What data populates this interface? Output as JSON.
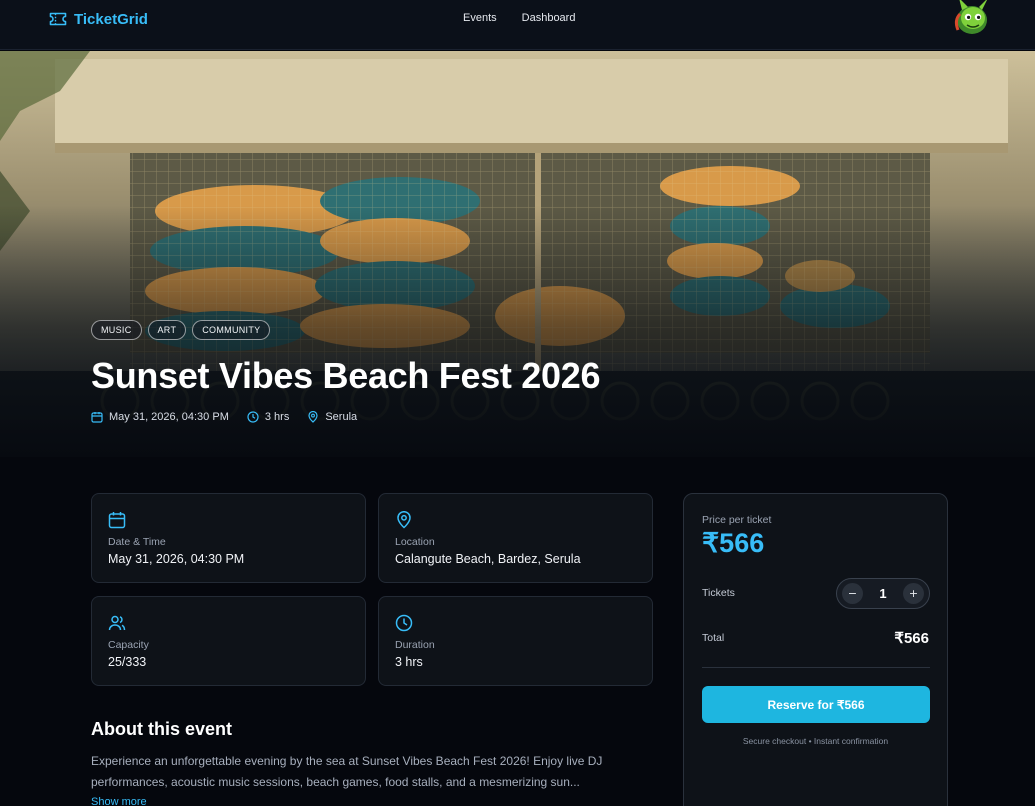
{
  "header": {
    "brand": "TicketGrid",
    "nav": {
      "events": "Events",
      "dashboard": "Dashboard"
    }
  },
  "hero": {
    "tags": [
      "MUSIC",
      "ART",
      "COMMUNITY"
    ],
    "title": "Sunset Vibes Beach Fest 2026",
    "meta": {
      "date": "May 31, 2026, 04:30 PM",
      "duration": "3 hrs",
      "venue": "Serula"
    }
  },
  "details": {
    "date": {
      "label": "Date & Time",
      "value": "May 31, 2026, 04:30 PM",
      "icon": "calendar-icon"
    },
    "location": {
      "label": "Location",
      "value": "Calangute Beach, Bardez, Serula",
      "icon": "map-pin-icon"
    },
    "capacity": {
      "label": "Capacity",
      "value": "25/333",
      "icon": "users-icon"
    },
    "duration": {
      "label": "Duration",
      "value": "3 hrs",
      "icon": "clock-icon"
    }
  },
  "about": {
    "title": "About this event",
    "body": "Experience an unforgettable evening by the sea at Sunset Vibes Beach Fest 2026! Enjoy live DJ performances, acoustic music sessions, beach games, food stalls, and a mesmerizing sun...",
    "show_more": "Show more"
  },
  "booking": {
    "price_label": "Price per ticket",
    "price": "₹566",
    "tickets_label": "Tickets",
    "quantity": "1",
    "minus": "−",
    "plus": "+",
    "total_label": "Total",
    "total": "₹566",
    "reserve_label": "Reserve for ₹566",
    "note": "Secure checkout • Instant confirmation"
  },
  "colors": {
    "accent": "#38bdf8",
    "button": "#1eb6e0",
    "background": "#05070d",
    "card": "#0e1218"
  }
}
